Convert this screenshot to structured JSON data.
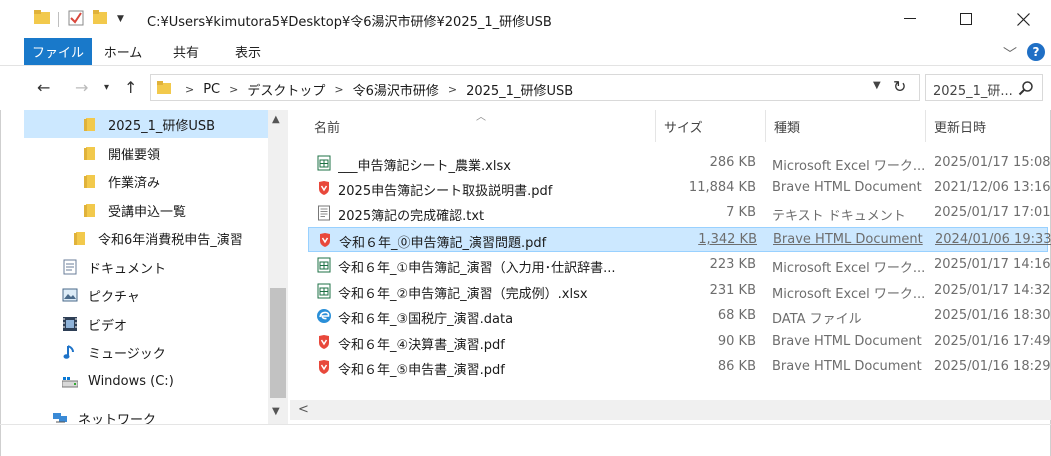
{
  "window": {
    "title_path": "C:¥Users¥kimutora5¥Desktop¥令6湯沢市研修¥2025_1_研修USB"
  },
  "ribbon": {
    "tabs": [
      "ファイル",
      "ホーム",
      "共有",
      "表示"
    ]
  },
  "address": {
    "crumbs": [
      "PC",
      "デスクトップ",
      "令6湯沢市研修",
      "2025_1_研修USB"
    ],
    "search_text": "2025_1_研..."
  },
  "nav_pane": {
    "items": [
      {
        "label": "2025_1_研修USB",
        "icon": "folder-icon",
        "selected": true
      },
      {
        "label": "開催要領",
        "icon": "folder-icon"
      },
      {
        "label": "作業済み",
        "icon": "folder-icon"
      },
      {
        "label": "受講申込一覧",
        "icon": "folder-icon"
      },
      {
        "label": "令和6年消費税申告_演習",
        "icon": "folder-icon"
      },
      {
        "label": "ドキュメント",
        "icon": "document-icon"
      },
      {
        "label": "ピクチャ",
        "icon": "picture-icon"
      },
      {
        "label": "ビデオ",
        "icon": "video-icon"
      },
      {
        "label": "ミュージック",
        "icon": "music-icon"
      },
      {
        "label": "Windows (C:)",
        "icon": "drive-icon"
      },
      {
        "label": "ネットワーク",
        "icon": "network-icon"
      }
    ]
  },
  "file_list": {
    "columns": [
      "名前",
      "サイズ",
      "種類",
      "更新日時"
    ],
    "rows": [
      {
        "name": "___申告簿記シート_農業.xlsx",
        "size": "286 KB",
        "type": "Microsoft Excel ワーク...",
        "date": "2025/01/17 15:08",
        "icon": "excel-icon"
      },
      {
        "name": "2025申告簿記シート取扱説明書.pdf",
        "size": "11,884 KB",
        "type": "Brave HTML Document",
        "date": "2021/12/06 13:16",
        "icon": "pdf-icon"
      },
      {
        "name": "2025簿記の完成確認.txt",
        "size": "7 KB",
        "type": "テキスト ドキュメント",
        "date": "2025/01/17 17:01",
        "icon": "text-file-icon"
      },
      {
        "name": "令和６年_⓪申告簿記_演習問題.pdf",
        "size": "1,342 KB",
        "type": "Brave HTML Document",
        "date": "2024/01/06 19:33",
        "icon": "pdf-icon",
        "selected": true
      },
      {
        "name": "令和６年_①申告簿記_演習（入力用･仕訳辞書...",
        "size": "223 KB",
        "type": "Microsoft Excel ワーク...",
        "date": "2025/01/17 14:16",
        "icon": "excel-icon"
      },
      {
        "name": "令和６年_②申告簿記_演習（完成例）.xlsx",
        "size": "231 KB",
        "type": "Microsoft Excel ワーク...",
        "date": "2025/01/17 14:32",
        "icon": "excel-icon"
      },
      {
        "name": "令和６年_③国税庁_演習.data",
        "size": "68 KB",
        "type": "DATA ファイル",
        "date": "2025/01/16 18:30",
        "icon": "edge-icon"
      },
      {
        "name": "令和６年_④決算書_演習.pdf",
        "size": "90 KB",
        "type": "Brave HTML Document",
        "date": "2025/01/16 17:49",
        "icon": "pdf-icon"
      },
      {
        "name": "令和６年_⑤申告書_演習.pdf",
        "size": "86 KB",
        "type": "Brave HTML Document",
        "date": "2025/01/16 18:29",
        "icon": "pdf-icon"
      }
    ]
  },
  "colors": {
    "accent": "#1979ca",
    "selection": "#cce8ff",
    "folder": "#f2c94c",
    "excel": "#1d7044",
    "pdf": "#e8483b"
  }
}
